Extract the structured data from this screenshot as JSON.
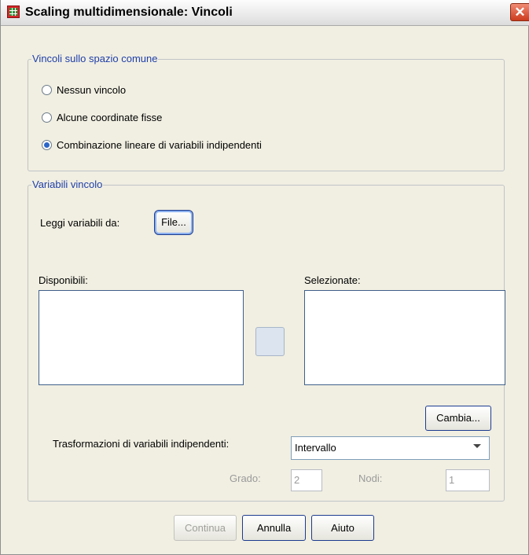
{
  "window": {
    "title": "Scaling multidimensionale: Vincoli",
    "close_label": "✕"
  },
  "constraints_group": {
    "legend": "Vincoli sullo spazio comune",
    "options": [
      {
        "label": "Nessun vincolo",
        "selected": false
      },
      {
        "label": "Alcune coordinate fisse",
        "selected": false
      },
      {
        "label": "Combinazione lineare di variabili indipendenti",
        "selected": true
      }
    ]
  },
  "variables_group": {
    "legend": "Variabili vincolo",
    "read_from_label": "Leggi variabili da:",
    "file_button": "File...",
    "available_label": "Disponibili:",
    "selected_label": "Selezionate:",
    "change_button": "Cambia...",
    "transform_label": "Trasformazioni di variabili indipendenti:",
    "transform_value": "Intervallo",
    "degree_label": "Grado:",
    "degree_value": "2",
    "nodes_label": "Nodi:",
    "nodes_value": "1"
  },
  "buttons": {
    "continue": "Continua",
    "cancel": "Annulla",
    "help": "Aiuto"
  },
  "colors": {
    "legend_text": "#1e3ea8",
    "dialog_bg": "#f1efe2",
    "selected_radio": "#2b66c8"
  }
}
